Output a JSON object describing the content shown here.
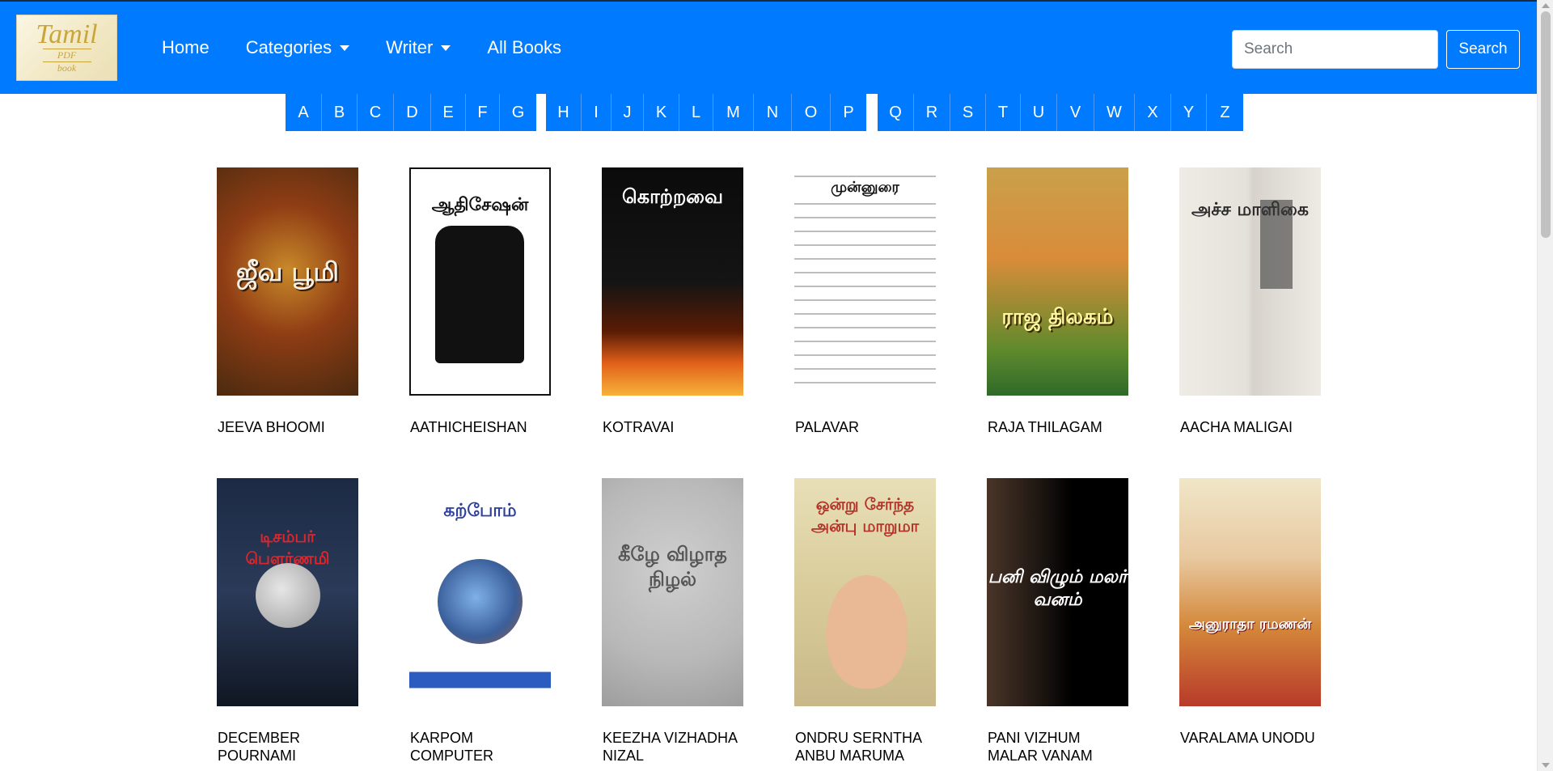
{
  "logo": {
    "line1": "Tamil",
    "line2": "PDF",
    "line3": "book"
  },
  "nav": {
    "home": "Home",
    "categories": "Categories",
    "writer": "Writer",
    "all_books": "All Books"
  },
  "search": {
    "placeholder": "Search",
    "button": "Search"
  },
  "alphabet": {
    "group1": [
      "A",
      "B",
      "C",
      "D",
      "E",
      "F",
      "G"
    ],
    "group2": [
      "H",
      "I",
      "J",
      "K",
      "L",
      "M",
      "N",
      "O",
      "P"
    ],
    "group3": [
      "Q",
      "R",
      "S",
      "T",
      "U",
      "V",
      "W",
      "X",
      "Y",
      "Z"
    ]
  },
  "books": [
    {
      "title": "JEEVA BHOOMI",
      "cover_text": "ஜீவ பூமி"
    },
    {
      "title": "AATHICHEISHAN",
      "cover_text": "ஆதிசேஷன்"
    },
    {
      "title": "KOTRAVAI",
      "cover_text": "கொற்றவை"
    },
    {
      "title": "PALAVAR",
      "cover_text": "முன்னுரை"
    },
    {
      "title": "RAJA THILAGAM",
      "cover_text": "ராஜ திலகம்"
    },
    {
      "title": "AACHA MALIGAI",
      "cover_text": "அச்ச மாளிகை"
    },
    {
      "title": "DECEMBER POURNAMI",
      "cover_text": "டிசம்பர் பௌர்ணமி"
    },
    {
      "title": "KARPOM COMPUTER",
      "cover_text": "கற்போம்"
    },
    {
      "title": "KEEZHA VIZHADHA NIZAL",
      "cover_text": "கீழே விழாத நிழல்"
    },
    {
      "title": "ONDRU SERNTHA ANBU MARUMA",
      "cover_text": "ஒன்று சேர்ந்த அன்பு மாறுமா"
    },
    {
      "title": "PANI VIZHUM MALAR VANAM",
      "cover_text": "பனி விழும் மலர் வனம்"
    },
    {
      "title": "VARALAMA UNODU",
      "cover_text": "அனுராதா ரமணன்"
    }
  ],
  "colors": {
    "primary": "#007bff",
    "white": "#ffffff"
  }
}
